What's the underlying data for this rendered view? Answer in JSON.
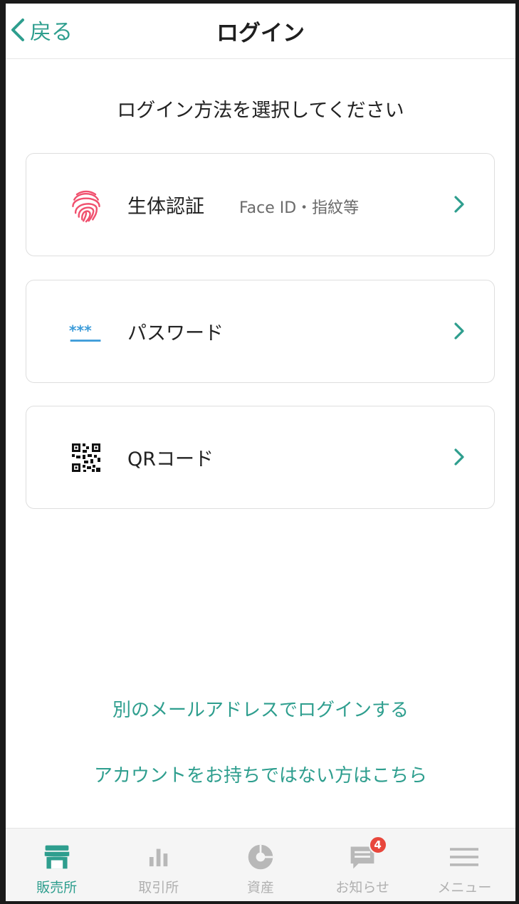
{
  "header": {
    "back_label": "戻る",
    "title": "ログイン"
  },
  "prompt": "ログイン方法を選択してください",
  "options": [
    {
      "label": "生体認証",
      "sub": "Face ID・指紋等",
      "icon": "fingerprint-icon"
    },
    {
      "label": "パスワード",
      "sub": "",
      "icon": "password-icon"
    },
    {
      "label": "QRコード",
      "sub": "",
      "icon": "qr-code-icon"
    }
  ],
  "links": {
    "other_email": "別のメールアドレスでログインする",
    "no_account": "アカウントをお持ちではない方はこちら"
  },
  "tabs": [
    {
      "label": "販売所",
      "icon": "store-icon",
      "active": true
    },
    {
      "label": "取引所",
      "icon": "bar-chart-icon",
      "active": false
    },
    {
      "label": "資産",
      "icon": "pie-chart-icon",
      "active": false
    },
    {
      "label": "お知らせ",
      "icon": "message-icon",
      "active": false,
      "badge": "4"
    },
    {
      "label": "メニュー",
      "icon": "menu-icon",
      "active": false
    }
  ],
  "colors": {
    "accent": "#2e9e8e",
    "fingerprint": "#f0506e",
    "password": "#3b9bd9",
    "badge": "#e8473c",
    "inactive": "#b0b0b0"
  }
}
